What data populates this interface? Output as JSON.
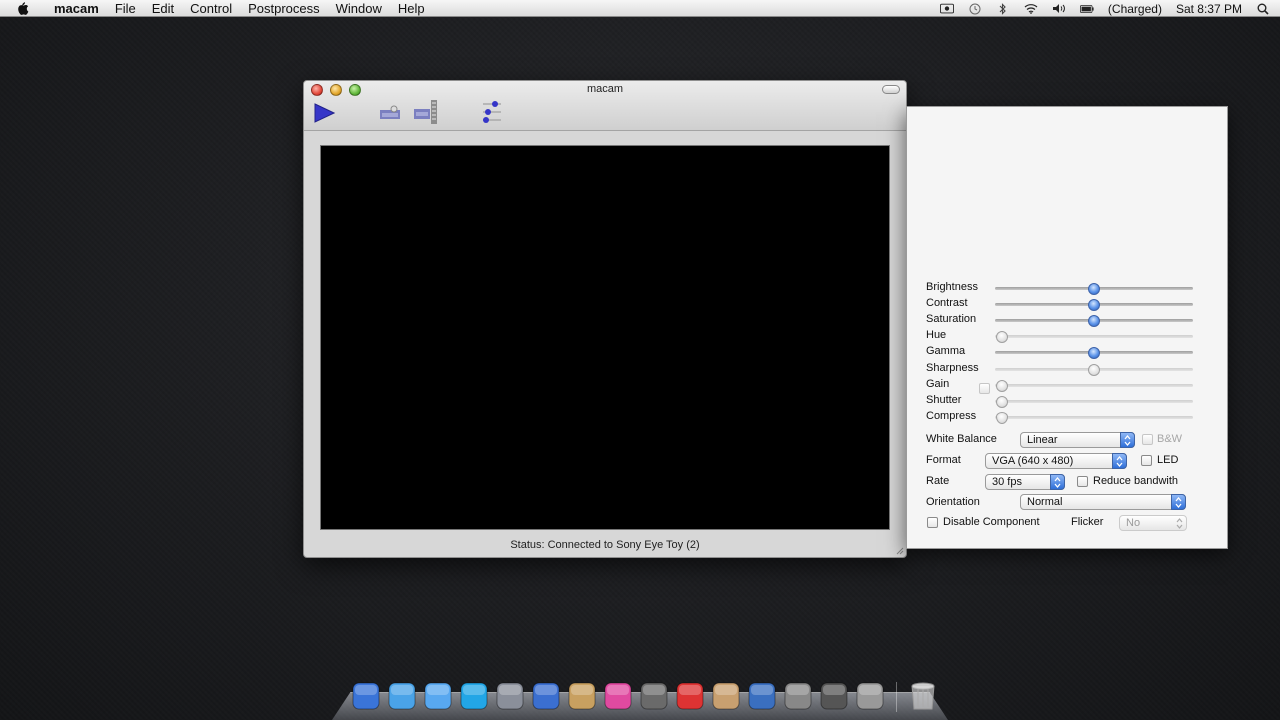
{
  "menubar": {
    "app_name": "macam",
    "items": [
      "File",
      "Edit",
      "Control",
      "Postprocess",
      "Window",
      "Help"
    ],
    "battery_status": "(Charged)",
    "clock": "Sat 8:37 PM"
  },
  "window": {
    "title": "macam",
    "status": "Status: Connected to Sony Eye Toy (2)"
  },
  "panel": {
    "sliders": [
      {
        "label": "Brightness",
        "level": 0.5,
        "active": true
      },
      {
        "label": "Contrast",
        "level": 0.5,
        "active": true
      },
      {
        "label": "Saturation",
        "level": 0.5,
        "active": true
      },
      {
        "label": "Hue",
        "level": 0.0,
        "active": false
      },
      {
        "label": "Gamma",
        "level": 0.5,
        "active": true
      },
      {
        "label": "Sharpness",
        "level": 0.5,
        "active": false
      },
      {
        "label": "Gain",
        "level": 0.0,
        "active": false
      },
      {
        "label": "Shutter",
        "level": 0.0,
        "active": false
      },
      {
        "label": "Compress",
        "level": 0.0,
        "active": false
      }
    ],
    "white_balance": {
      "label": "White Balance",
      "value": "Linear"
    },
    "bw_label": "B&W",
    "format": {
      "label": "Format",
      "value": "VGA (640 x 480)"
    },
    "led_label": "LED",
    "rate": {
      "label": "Rate",
      "value": "30 fps"
    },
    "reduce_bandwidth_label": "Reduce bandwith",
    "orientation": {
      "label": "Orientation",
      "value": "Normal"
    },
    "disable_component_label": "Disable Component",
    "flicker": {
      "label": "Flicker",
      "value": "No"
    }
  },
  "colors": {
    "accent": "#3a78dc",
    "desktop": "#1e1f22",
    "play": "#3535c8"
  },
  "dock": {
    "icons": [
      "finder-icon",
      "safari-icon",
      "ichat-icon",
      "skype-icon",
      "preview-icon",
      "itunes-icon",
      "coffee-icon",
      "color-prism-icon",
      "photo-booth-icon",
      "textedit-icon",
      "script-editor-icon",
      "xcode-icon",
      "screen-sharing-icon",
      "imovie-icon",
      "webcam-icon",
      "trash-icon"
    ]
  }
}
